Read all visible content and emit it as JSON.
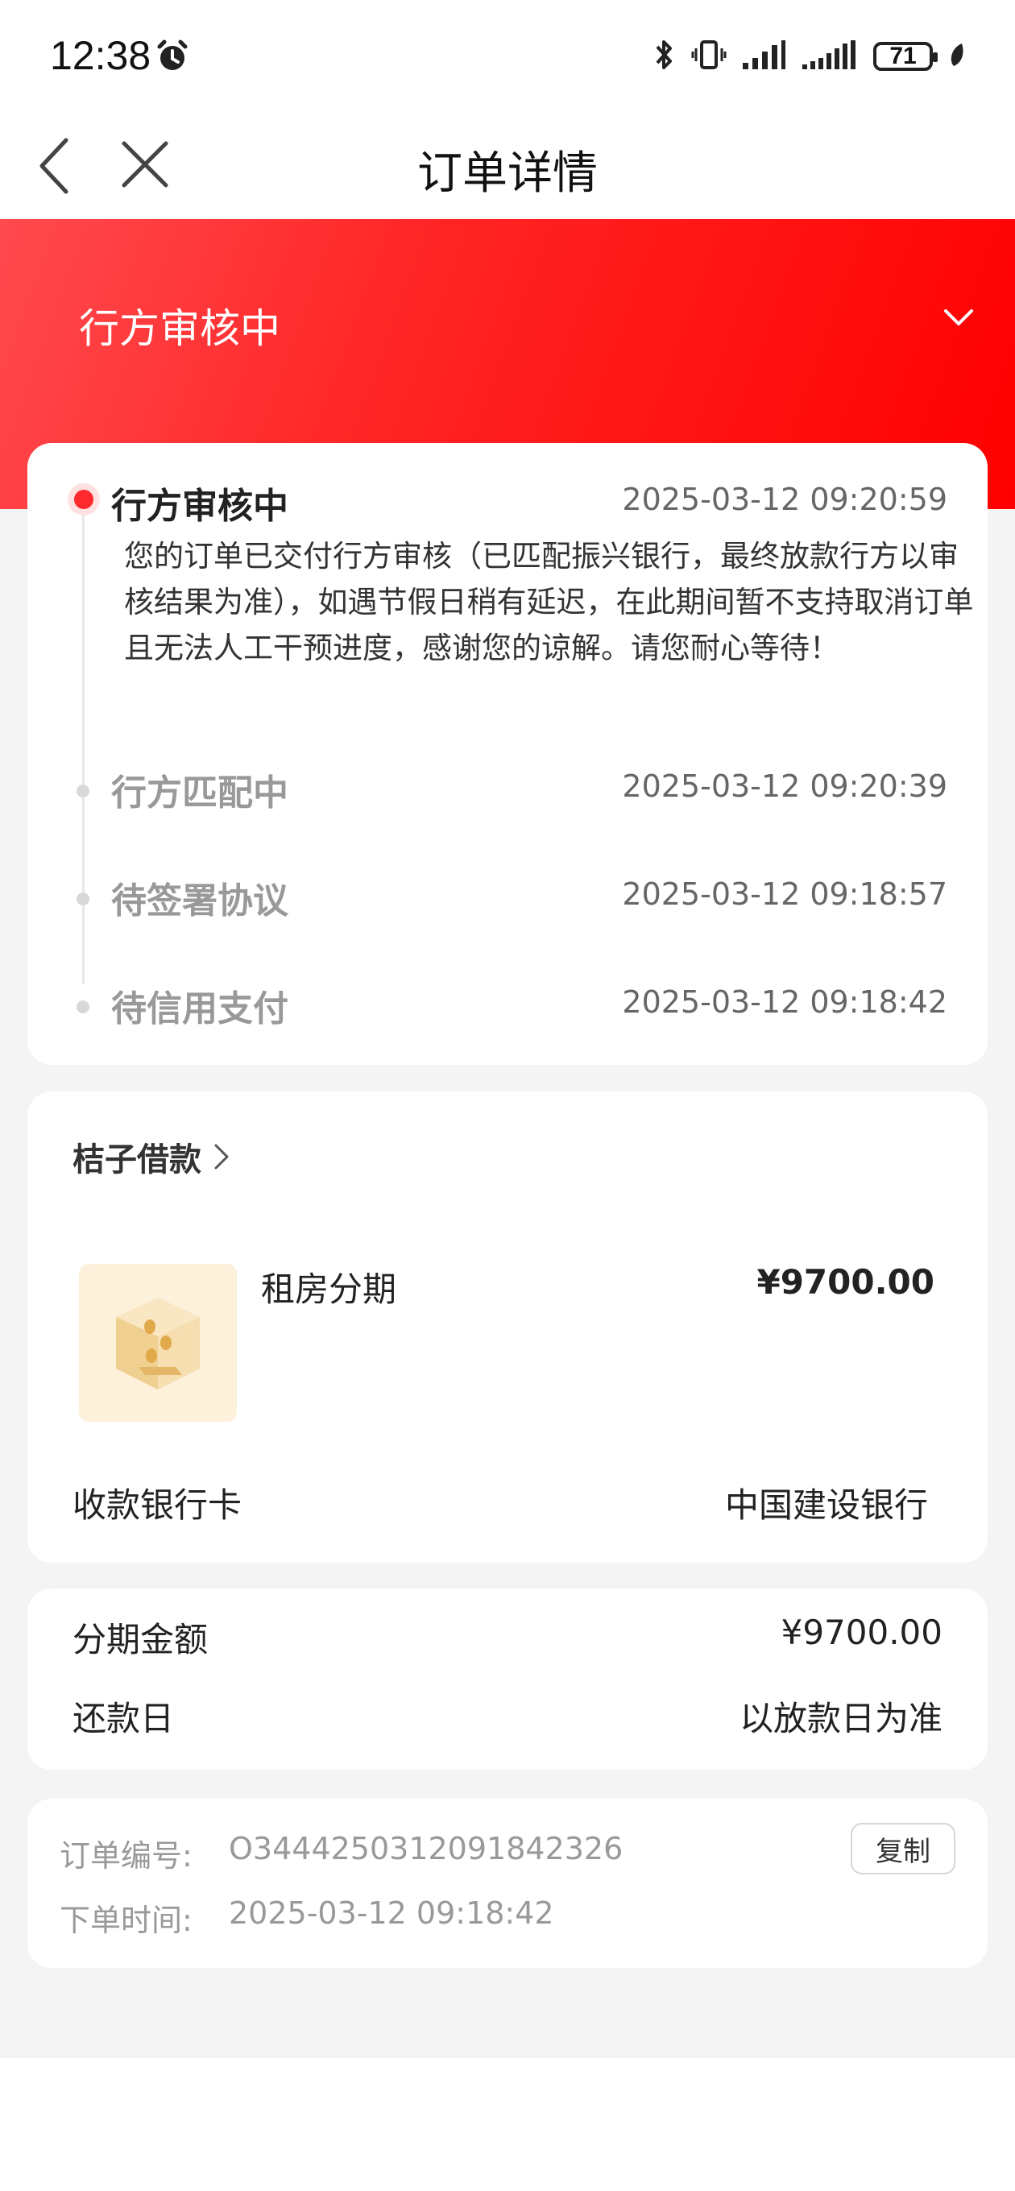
{
  "status_bar": {
    "time": "12:38",
    "battery": "71"
  },
  "nav": {
    "title": "订单详情"
  },
  "banner": {
    "status": "行方审核中"
  },
  "timeline": [
    {
      "title": "行方审核中",
      "time": "2025-03-12 09:20:59",
      "desc": "您的订单已交付行方审核（已匹配振兴银行，最终放款行方以审核结果为准），如遇节假日稍有延迟，在此期间暂不支持取消订单且无法人工干预进度，感谢您的谅解。请您耐心等待！"
    },
    {
      "title": "行方匹配中",
      "time": "2025-03-12 09:20:39"
    },
    {
      "title": "待签署协议",
      "time": "2025-03-12 09:18:57"
    },
    {
      "title": "待信用支付",
      "time": "2025-03-12 09:18:42"
    }
  ],
  "order": {
    "merchant": "桔子借款",
    "product_name": "租房分期",
    "product_price": "¥9700.00",
    "bank_label": "收款银行卡",
    "bank_value": "中国建设银行"
  },
  "installment": {
    "amount_label": "分期金额",
    "amount_value": "¥9700.00",
    "repay_label": "还款日",
    "repay_value": "以放款日为准"
  },
  "meta": {
    "order_no_label": "订单编号:",
    "order_no": "O34442503120918423​26",
    "copy_label": "复制",
    "time_label": "下单时间:",
    "time_value": "2025-03-12 09:18:42"
  },
  "colors": {
    "accent": "#fe2a2e"
  }
}
